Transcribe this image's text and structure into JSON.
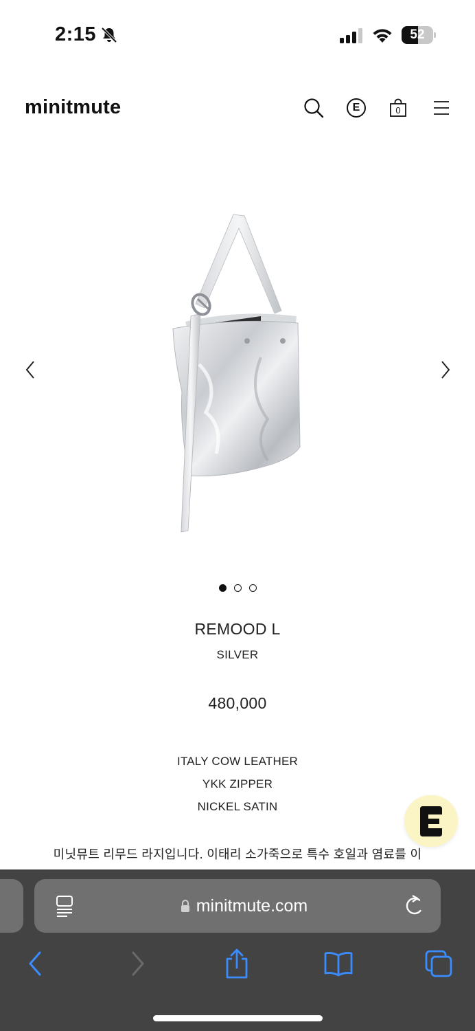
{
  "status": {
    "time": "2:15",
    "battery": "52",
    "battery_level": 0.52
  },
  "site": {
    "logo": "minitmute",
    "header_icons": [
      "search-icon",
      "e-circle-icon",
      "shopping-bag-icon",
      "menu-icon"
    ],
    "e_label": "E",
    "cart_count": "0"
  },
  "carousel": {
    "image": "silver-bucket-bag",
    "slides": 3,
    "active_slide": 1
  },
  "product": {
    "name": "REMOOD L",
    "color": "SILVER",
    "price": "480,000",
    "specs": [
      "ITALY COW LEATHER",
      "YKK ZIPPER",
      "NICKEL SATIN"
    ],
    "description": "미닛뮤트 리무드 라지입니다. 이태리 소가죽으로 특수 호일과 염료를 이"
  },
  "browser": {
    "url": "minitmute.com",
    "icons": [
      "reader-icon",
      "lock-icon",
      "reload-icon",
      "back-icon",
      "forward-icon",
      "share-icon",
      "bookmarks-icon",
      "tabs-icon"
    ],
    "colors": {
      "bar": "#434343",
      "field": "#707070",
      "accent": "#3a8cff"
    }
  },
  "floating_badge": {
    "icon": "e-logo-icon",
    "color": "#fbf4c4"
  }
}
